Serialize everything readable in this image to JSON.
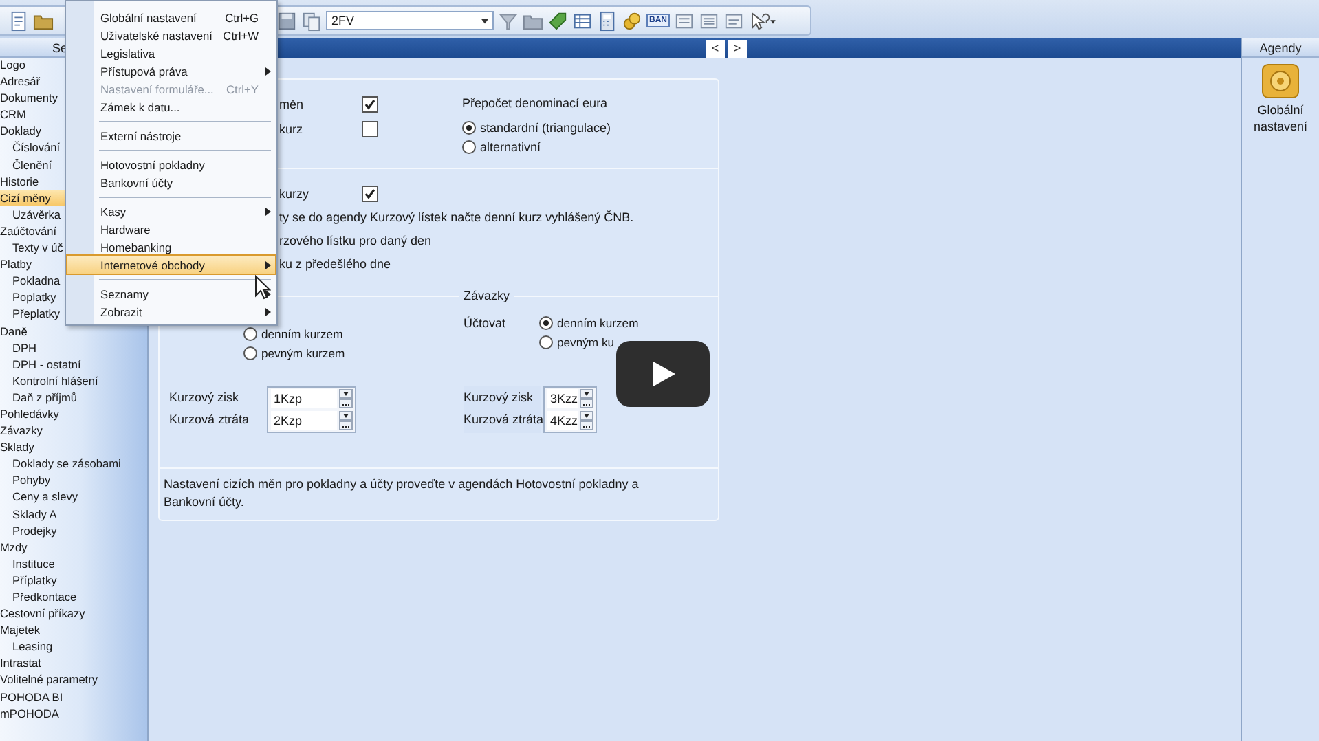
{
  "toolbar": {
    "combo_value": "2FV",
    "bank_badge": "BAN"
  },
  "sidebar": {
    "title": "Se",
    "items": [
      {
        "label": "Logo",
        "selected": false
      },
      {
        "label": "Adresář",
        "selected": false
      },
      {
        "label": "Dokumenty",
        "selected": false
      },
      {
        "label": "CRM",
        "selected": false
      },
      {
        "label": "Doklady",
        "selected": false,
        "children": [
          {
            "label": "Číslování",
            "selected": false
          },
          {
            "label": "Členění",
            "selected": false
          }
        ]
      },
      {
        "label": "Historie",
        "selected": false
      },
      {
        "label": "Cizí měny",
        "selected": true,
        "children": [
          {
            "label": "Uzávěrka",
            "selected": false
          }
        ]
      },
      {
        "label": "Zaúčtování",
        "selected": false,
        "children": [
          {
            "label": "Texty v úč",
            "selected": false
          }
        ]
      },
      {
        "label": "Platby",
        "selected": false,
        "children": [
          {
            "label": "Pokladna",
            "selected": false
          },
          {
            "label": "Poplatky",
            "selected": false
          },
          {
            "label": "Přeplatky",
            "selected": false
          }
        ]
      },
      {
        "label": "Daně",
        "selected": false,
        "children": [
          {
            "label": "DPH",
            "selected": false
          },
          {
            "label": "DPH - ostatní",
            "selected": false
          },
          {
            "label": "Kontrolní hlášení",
            "selected": false
          },
          {
            "label": "Daň z příjmů",
            "selected": false
          }
        ]
      },
      {
        "label": "Pohledávky",
        "selected": false
      },
      {
        "label": "Závazky",
        "selected": false
      },
      {
        "label": "Sklady",
        "selected": false,
        "children": [
          {
            "label": "Doklady se zásobami",
            "selected": false
          },
          {
            "label": "Pohyby",
            "selected": false
          },
          {
            "label": "Ceny a slevy",
            "selected": false
          },
          {
            "label": "Sklady A",
            "selected": false
          },
          {
            "label": "Prodejky",
            "selected": false
          }
        ]
      },
      {
        "label": "Mzdy",
        "selected": false,
        "children": [
          {
            "label": "Instituce",
            "selected": false
          },
          {
            "label": "Příplatky",
            "selected": false
          },
          {
            "label": "Předkontace",
            "selected": false
          }
        ]
      },
      {
        "label": "Cestovní příkazy",
        "selected": false
      },
      {
        "label": "Majetek",
        "selected": false,
        "children": [
          {
            "label": "Leasing",
            "selected": false
          }
        ]
      },
      {
        "label": "Intrastat",
        "selected": false
      },
      {
        "label": "Volitelné parametry",
        "selected": false
      },
      {
        "label": "POHODA BI",
        "selected": false
      },
      {
        "label": "mPOHODA",
        "selected": false
      }
    ]
  },
  "menu": {
    "items": [
      {
        "kind": "item",
        "label": "Globální nastavení",
        "shortcut": "Ctrl+G",
        "submenu": false,
        "disabled": false,
        "selected": false
      },
      {
        "kind": "item",
        "label": "Uživatelské nastavení",
        "shortcut": "Ctrl+W",
        "submenu": false,
        "disabled": false,
        "selected": false
      },
      {
        "kind": "item",
        "label": "Legislativa",
        "submenu": false,
        "disabled": false,
        "selected": false
      },
      {
        "kind": "item",
        "label": "Přístupová práva",
        "submenu": true,
        "disabled": false,
        "selected": false
      },
      {
        "kind": "item",
        "label": "Nastavení formuláře...",
        "shortcut": "Ctrl+Y",
        "submenu": false,
        "disabled": true,
        "selected": false
      },
      {
        "kind": "item",
        "label": "Zámek k datu...",
        "submenu": false,
        "disabled": false,
        "selected": false
      },
      {
        "kind": "separator"
      },
      {
        "kind": "item",
        "label": "Externí nástroje",
        "submenu": false,
        "disabled": false,
        "selected": false
      },
      {
        "kind": "separator"
      },
      {
        "kind": "item",
        "label": "Hotovostní pokladny",
        "submenu": false,
        "disabled": false,
        "selected": false
      },
      {
        "kind": "item",
        "label": "Bankovní účty",
        "submenu": false,
        "disabled": false,
        "selected": false
      },
      {
        "kind": "separator"
      },
      {
        "kind": "item",
        "label": "Kasy",
        "submenu": true,
        "disabled": false,
        "selected": false
      },
      {
        "kind": "item",
        "label": "Hardware",
        "submenu": false,
        "disabled": false,
        "selected": false
      },
      {
        "kind": "item",
        "label": "Homebanking",
        "submenu": false,
        "disabled": false,
        "selected": false
      },
      {
        "kind": "item",
        "label": "Internetové obchody",
        "submenu": true,
        "disabled": false,
        "selected": true
      },
      {
        "kind": "separator"
      },
      {
        "kind": "item",
        "label": "Seznamy",
        "submenu": true,
        "disabled": false,
        "selected": false
      },
      {
        "kind": "item",
        "label": "Zobrazit",
        "submenu": true,
        "disabled": false,
        "selected": false
      }
    ]
  },
  "content": {
    "nav": [
      "<",
      ">"
    ],
    "currencies": {
      "rows": [
        {
          "label": "měn",
          "checked": true
        },
        {
          "label": "kurz",
          "checked": false
        }
      ],
      "euro": {
        "heading": "Přepočet denominací eura",
        "options": [
          {
            "label": "standardní  (triangulace)",
            "selected": true
          },
          {
            "label": "alternativní",
            "selected": false
          }
        ]
      }
    },
    "rates": {
      "check": {
        "label": "kurzy",
        "checked": true
      },
      "lines": [
        "ty se do agendy Kurzový lístek načte denní kurz vyhlášený ČNB.",
        "rzového lístku pro daný den",
        "ku z předešlého dne"
      ]
    },
    "posting": {
      "left": {
        "options": [
          {
            "label": "denním kurzem",
            "selected": false
          },
          {
            "label": "pevným kurzem",
            "selected": false
          }
        ],
        "fields": [
          {
            "label": "Kurzový zisk",
            "value": "1Kzp"
          },
          {
            "label": "Kurzová ztráta",
            "value": "2Kzp"
          }
        ]
      },
      "right": {
        "heading": "Závazky",
        "label": "Účtovat",
        "options": [
          {
            "label": "denním kurzem",
            "selected": true
          },
          {
            "label": "pevným ku",
            "selected": false
          }
        ],
        "fields": [
          {
            "label": "Kurzový zisk",
            "value": "3Kzz"
          },
          {
            "label": "Kurzová ztráta",
            "value": "4Kzz"
          }
        ]
      }
    },
    "note": "Nastavení cizích měn pro pokladny a účty proveďte v agendách Hotovostní pokladny a Bankovní účty."
  },
  "agendas": {
    "title": "Agendy",
    "items": [
      {
        "label": "Globální nastavení"
      }
    ]
  }
}
